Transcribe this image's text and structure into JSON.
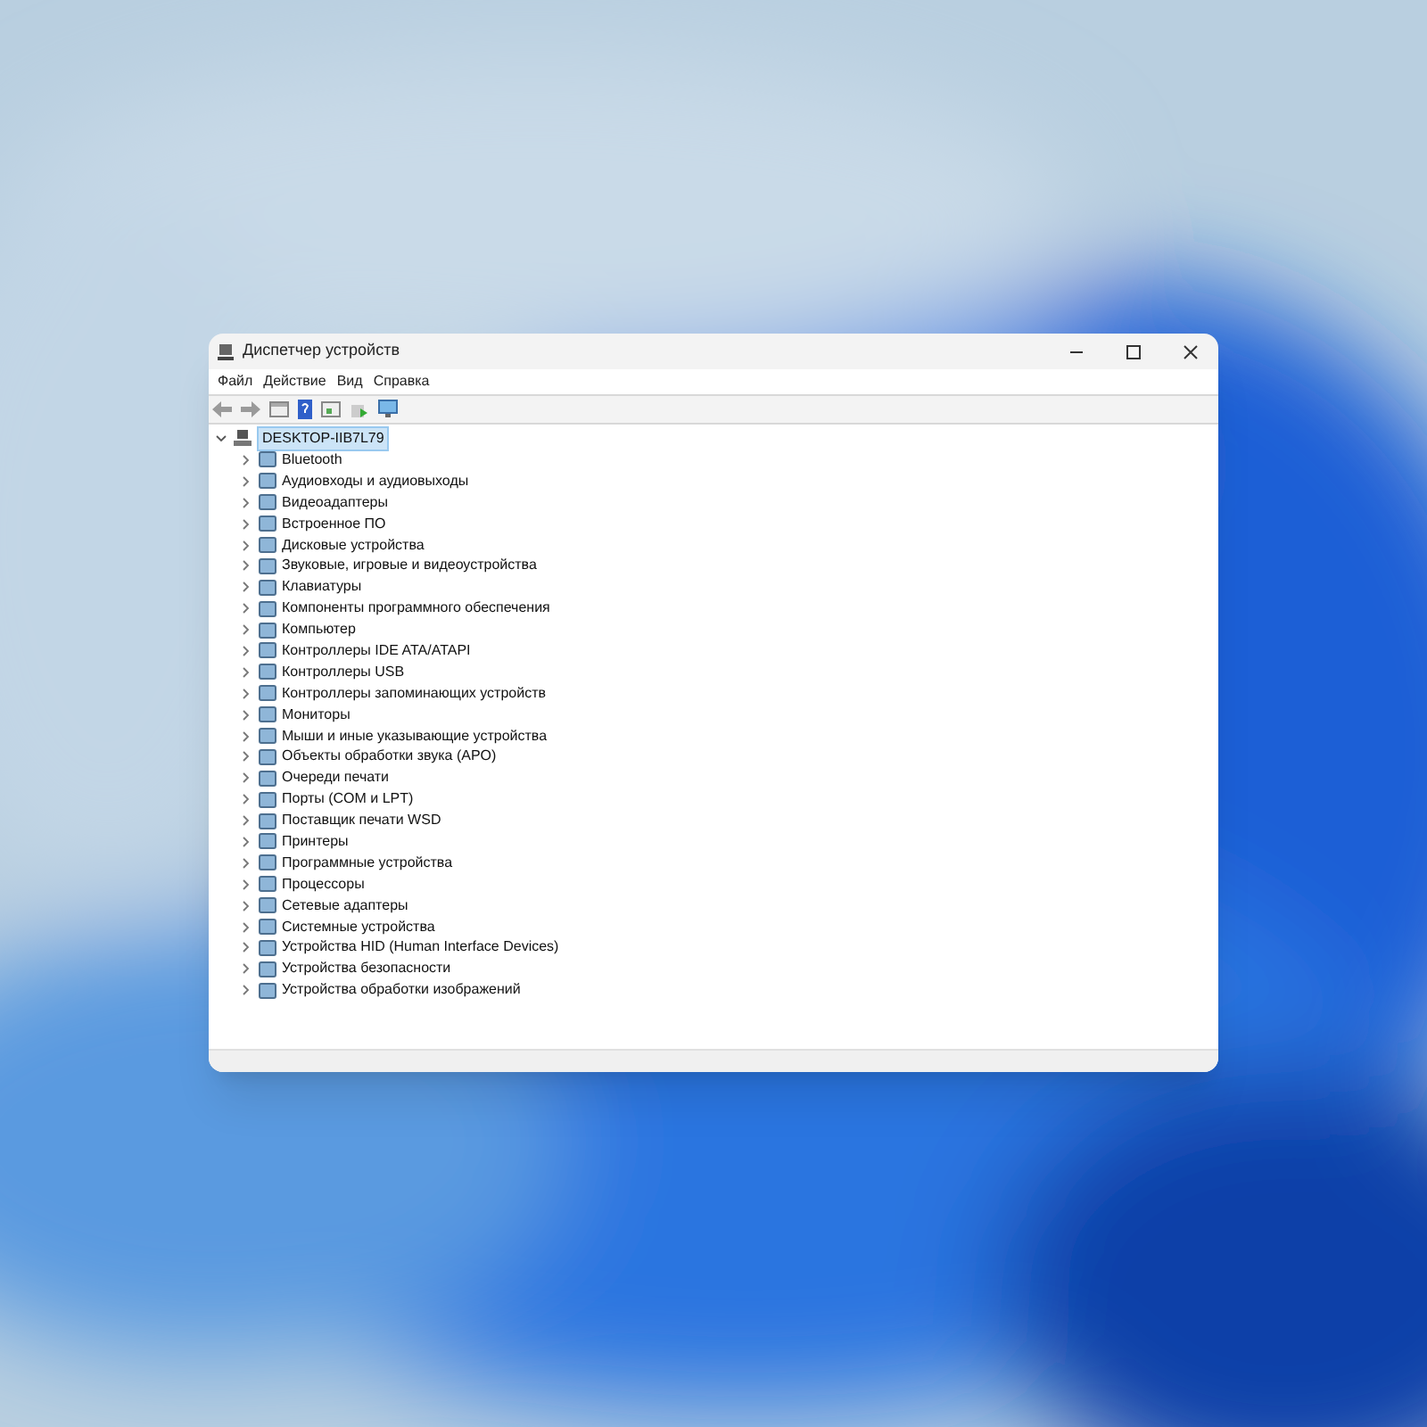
{
  "window": {
    "title": "Диспетчер устройств"
  },
  "menu": [
    "Файл",
    "Действие",
    "Вид",
    "Справка"
  ],
  "tree": {
    "label": "DESKTOP-IIB7L79",
    "selected": true,
    "expanded": true,
    "children": [
      {
        "label": "Bluetooth",
        "expanded": false
      },
      {
        "label": "Аудиовходы и аудиовыходы",
        "expanded": false
      },
      {
        "label": "Видеоадаптеры",
        "expanded": false
      },
      {
        "label": "Встроенное ПО",
        "expanded": false
      },
      {
        "label": "Дисковые устройства",
        "expanded": false
      },
      {
        "label": "Звуковые, игровые и видеоустройства",
        "expanded": false
      },
      {
        "label": "Клавиатуры",
        "expanded": false
      },
      {
        "label": "Компоненты программного обеспечения",
        "expanded": false
      },
      {
        "label": "Компьютер",
        "expanded": false
      },
      {
        "label": "Контроллеры IDE ATA/ATAPI",
        "expanded": false
      },
      {
        "label": "Контроллеры USB",
        "expanded": false
      },
      {
        "label": "Контроллеры запоминающих устройств",
        "expanded": false
      },
      {
        "label": "Мониторы",
        "expanded": false
      },
      {
        "label": "Мыши и иные указывающие устройства",
        "expanded": false
      },
      {
        "label": "Объекты обработки звука (APO)",
        "expanded": false
      },
      {
        "label": "Очереди печати",
        "expanded": false
      },
      {
        "label": "Порты (COM и LPT)",
        "expanded": false
      },
      {
        "label": "Поставщик печати WSD",
        "expanded": false
      },
      {
        "label": "Принтеры",
        "expanded": false
      },
      {
        "label": "Программные устройства",
        "expanded": false
      },
      {
        "label": "Процессоры",
        "expanded": false
      },
      {
        "label": "Сетевые адаптеры",
        "expanded": false
      },
      {
        "label": "Системные устройства",
        "expanded": false
      },
      {
        "label": "Устройства HID (Human Interface Devices)",
        "expanded": false
      },
      {
        "label": "Устройства безопасности",
        "expanded": false
      },
      {
        "label": "Устройства обработки изображений",
        "expanded": false
      }
    ]
  }
}
